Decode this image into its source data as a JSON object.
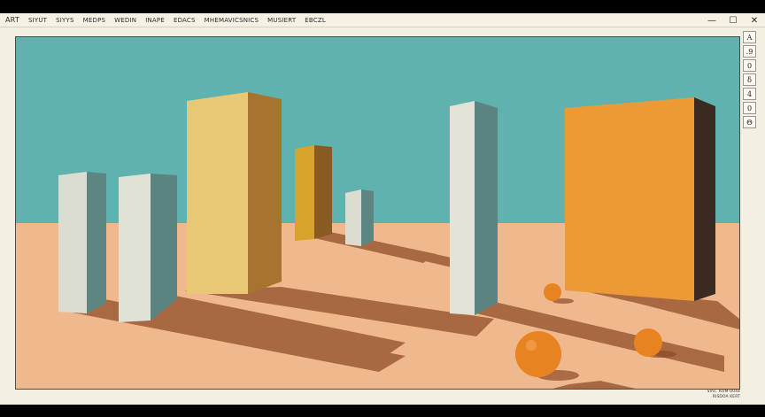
{
  "menubar": {
    "items": [
      {
        "label": "ART"
      },
      {
        "label": "SIYUT"
      },
      {
        "label": "SIYYS"
      },
      {
        "label": "MEDPS"
      },
      {
        "label": "WEDIN"
      },
      {
        "label": "INAPE"
      },
      {
        "label": "EDACS"
      },
      {
        "label": "MHEMAVICSNICS"
      },
      {
        "label": "MUSIERT"
      },
      {
        "label": "EBCZL"
      }
    ]
  },
  "window_controls": {
    "minimize": "—",
    "maximize": "☐",
    "close": "✕"
  },
  "side_toolbar": {
    "tools": [
      {
        "label": "A"
      },
      {
        "label": ".9"
      },
      {
        "label": "0"
      },
      {
        "label": "δ"
      },
      {
        "label": "4"
      },
      {
        "label": "0"
      },
      {
        "label": "Θ"
      }
    ]
  },
  "caption": {
    "line1": "Sms. ROM-0044",
    "line2": "RISDOA KERT"
  },
  "colors": {
    "sky": "#5fb2ad",
    "ground": "#f0b98d",
    "shadow": "#9c5a36",
    "pillar_light": "#dfe0d4",
    "pillar_shade": "#5b8480",
    "yellow": "#e9c875",
    "yellow_shade": "#a6742f",
    "mustard": "#d7a32a",
    "orange": "#ec9a35",
    "dark": "#3a2a22",
    "fruit": "#e88322"
  }
}
